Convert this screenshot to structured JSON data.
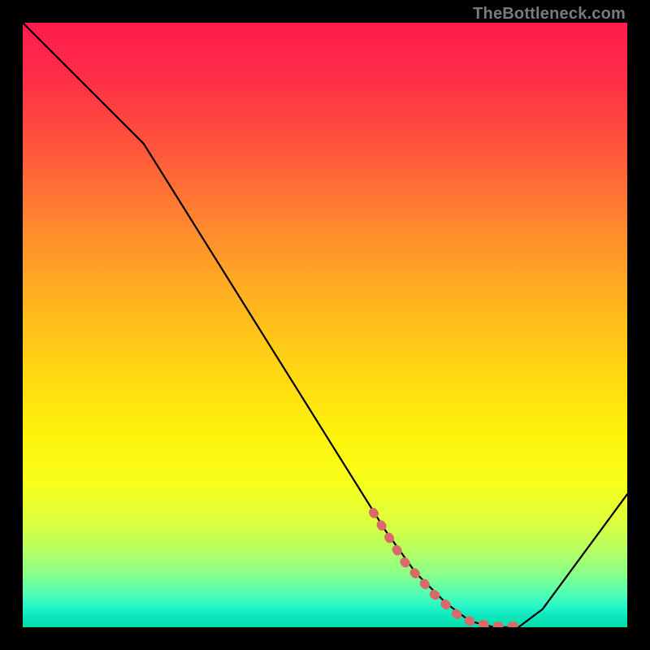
{
  "watermark": "TheBottleneck.com",
  "colors": {
    "frame": "#000000",
    "curve_stroke": "#000000",
    "dotted_stroke": "#d96a6a",
    "gradient_top": "#ff1a4d",
    "gradient_bottom": "#05dca8"
  },
  "chart_data": {
    "type": "line",
    "title": "",
    "xlabel": "",
    "ylabel": "",
    "xlim": [
      0,
      100
    ],
    "ylim": [
      0,
      100
    ],
    "grid": false,
    "legend": false,
    "series": [
      {
        "name": "bottleneck-curve",
        "x": [
          0,
          8,
          20,
          30,
          40,
          50,
          60,
          65,
          70,
          74,
          78,
          82,
          86,
          100
        ],
        "values": [
          100,
          92,
          80,
          64,
          48,
          32,
          16,
          9,
          4,
          1,
          0,
          0,
          3,
          22
        ]
      }
    ],
    "highlight": {
      "name": "dotted-optimal-band",
      "x": [
        58,
        63,
        68,
        72,
        74,
        76,
        78,
        80,
        82
      ],
      "values": [
        19,
        11,
        5.5,
        2,
        1,
        0.5,
        0.2,
        0.1,
        0.3
      ]
    }
  }
}
